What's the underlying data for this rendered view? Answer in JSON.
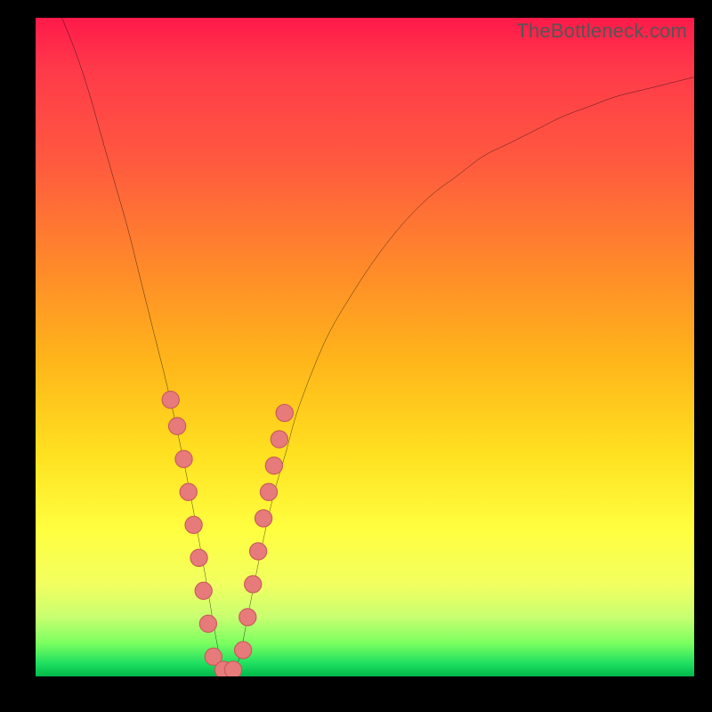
{
  "watermark": "TheBottleneck.com",
  "colors": {
    "frame": "#000000",
    "curve_stroke": "#000000",
    "marker_fill": "#e77a7a",
    "marker_stroke": "#c95a5a"
  },
  "chart_data": {
    "type": "line",
    "title": "",
    "xlabel": "",
    "ylabel": "",
    "xlim": [
      0,
      100
    ],
    "ylim": [
      0,
      100
    ],
    "grid": false,
    "legend": false,
    "series": [
      {
        "name": "bottleneck-curve",
        "x": [
          4,
          6,
          8,
          10,
          12,
          14,
          16,
          18,
          20,
          22,
          24,
          26,
          27,
          28,
          29,
          30,
          31,
          32,
          34,
          36,
          38,
          40,
          44,
          48,
          52,
          56,
          60,
          64,
          68,
          72,
          76,
          80,
          84,
          88,
          92,
          96,
          100
        ],
        "y": [
          100,
          95,
          89,
          82,
          75,
          68,
          60,
          52,
          44,
          35,
          25,
          14,
          8,
          3,
          1,
          1,
          3,
          8,
          18,
          27,
          34,
          41,
          51,
          58,
          64,
          69,
          73,
          76,
          79,
          81,
          83,
          85,
          86.5,
          88,
          89,
          90,
          91
        ]
      }
    ],
    "markers": {
      "name": "highlight-points",
      "x": [
        20.5,
        21.5,
        22.5,
        23.2,
        24.0,
        24.8,
        25.5,
        26.2,
        27.0,
        28.5,
        30.0,
        31.5,
        32.2,
        33.0,
        33.8,
        34.6,
        35.4,
        36.2,
        37.0,
        37.8
      ],
      "y": [
        42,
        38,
        33,
        28,
        23,
        18,
        13,
        8,
        3,
        1,
        1,
        4,
        9,
        14,
        19,
        24,
        28,
        32,
        36,
        40
      ]
    },
    "background_gradient": {
      "top": "#ff1a4a",
      "mid": "#ffe020",
      "bottom": "#00b84a"
    }
  }
}
